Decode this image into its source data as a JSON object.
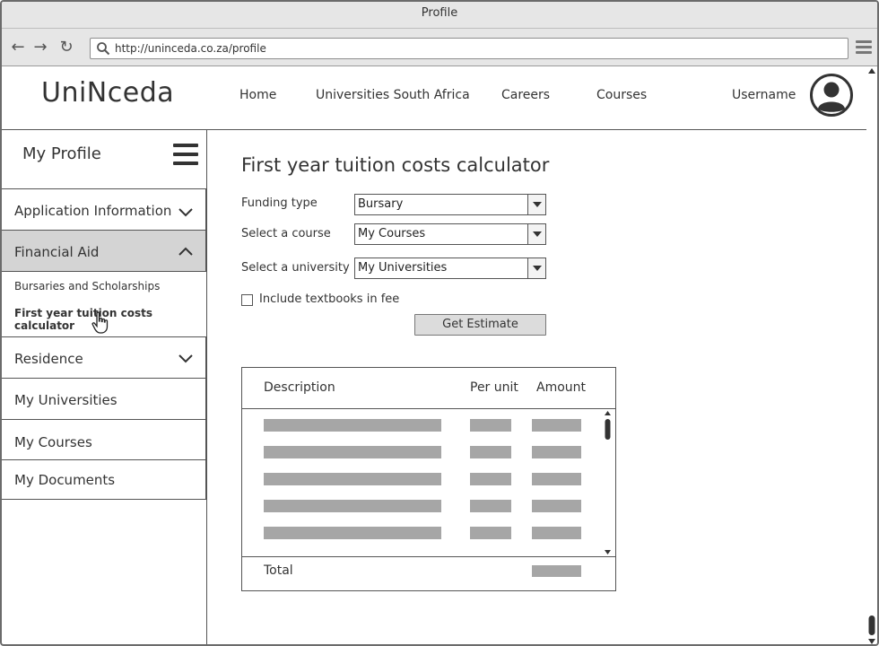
{
  "window": {
    "title": "Profile"
  },
  "browser": {
    "url": "http://uninceda.co.za/profile"
  },
  "site": {
    "logo": "UniNceda",
    "nav": [
      {
        "label": "Home"
      },
      {
        "label": "Universities South Africa"
      },
      {
        "label": "Careers"
      },
      {
        "label": "Courses"
      }
    ],
    "username": "Username"
  },
  "sidebar": {
    "title": "My Profile",
    "sections": [
      {
        "label": "Application Information",
        "expanded": false
      },
      {
        "label": "Financial Aid",
        "expanded": true,
        "active": true,
        "items": [
          {
            "label": "Bursaries and Scholarships"
          },
          {
            "label": "First year tuition costs calculator",
            "selected": true
          }
        ]
      },
      {
        "label": "Residence",
        "expanded": false
      }
    ],
    "items": [
      {
        "label": "My Universities"
      },
      {
        "label": "My Courses"
      },
      {
        "label": "My Documents"
      }
    ]
  },
  "main": {
    "title": "First year tuition costs calculator",
    "form": {
      "funding_label": "Funding type",
      "funding_value": "Bursary",
      "course_label": "Select a course",
      "course_value": "My Courses",
      "university_label": "Select a university",
      "university_value": "My Universities",
      "textbooks_label": "Include textbooks in fee",
      "textbooks_checked": false,
      "submit_label": "Get Estimate"
    },
    "table": {
      "headers": [
        "Description",
        "Per unit",
        "Amount"
      ],
      "placeholder_rows": 5,
      "total_label": "Total"
    }
  },
  "colors": {
    "placeholder_bar": "#a6a6a6",
    "active_section_bg": "#d4d4d4",
    "chrome_bg": "#e6e6e6"
  }
}
